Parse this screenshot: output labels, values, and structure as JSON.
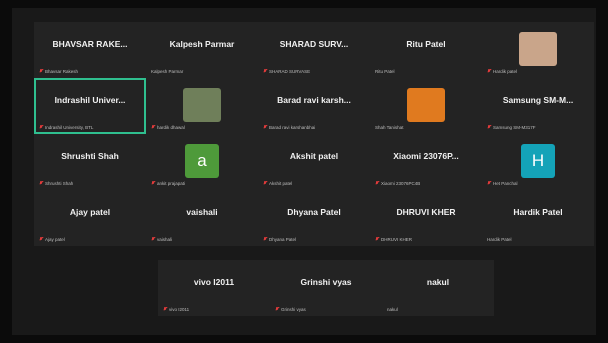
{
  "participants_main": [
    {
      "name": "BHAVSAR RAKE...",
      "sub": "Bhavsar Rakesh",
      "muted": true,
      "avatar": null
    },
    {
      "name": "Kalpesh Parmar",
      "sub": "Kalpesh Parmar",
      "muted": false,
      "avatar": null
    },
    {
      "name": "SHARAD SURV...",
      "sub": "SHARAD SURVASE",
      "muted": true,
      "avatar": null
    },
    {
      "name": "Ritu Patel",
      "sub": "Ritu Patel",
      "muted": false,
      "avatar": null
    },
    {
      "name": "",
      "sub": "Hardik patel",
      "muted": true,
      "avatar": {
        "type": "photo",
        "color": "#c9a58a"
      }
    },
    {
      "name": "Indrashil Univer...",
      "sub": "Indrashil University, BTL",
      "muted": true,
      "avatar": null,
      "active": true
    },
    {
      "name": "",
      "sub": "hardik dhawal",
      "muted": true,
      "avatar": {
        "type": "photo",
        "color": "#6f7f5a"
      }
    },
    {
      "name": "Barad ravi karsh...",
      "sub": "Barad ravi karshanbhai",
      "muted": true,
      "avatar": null
    },
    {
      "name": "",
      "sub": "Shah Tanishat",
      "muted": false,
      "avatar": {
        "type": "photo",
        "color": "#e07a1f"
      }
    },
    {
      "name": "Samsung SM-M...",
      "sub": "Samsung SM-M317F",
      "muted": true,
      "avatar": null
    },
    {
      "name": "Shrushti Shah",
      "sub": "Shrushti Shah",
      "muted": true,
      "avatar": null
    },
    {
      "name": "",
      "sub": "ankit prajapati",
      "muted": true,
      "avatar": {
        "type": "letter",
        "letter": "a",
        "color": "#4e9a3a"
      }
    },
    {
      "name": "Akshit patel",
      "sub": "Akshit patel",
      "muted": true,
      "avatar": null
    },
    {
      "name": "Xiaomi 23076P...",
      "sub": "Xiaomi 23076PC4B",
      "muted": true,
      "avatar": null
    },
    {
      "name": "",
      "sub": "Het Panchal",
      "muted": true,
      "avatar": {
        "type": "letter",
        "letter": "H",
        "color": "#14a3b8"
      }
    },
    {
      "name": "Ajay patel",
      "sub": "Ajay patel",
      "muted": true,
      "avatar": null
    },
    {
      "name": "vaishali",
      "sub": "vaishali",
      "muted": true,
      "avatar": null
    },
    {
      "name": "Dhyana Patel",
      "sub": "Dhyana Patel",
      "muted": true,
      "avatar": null
    },
    {
      "name": "DHRUVI KHER",
      "sub": "DHRUVI KHER",
      "muted": true,
      "avatar": null
    },
    {
      "name": "Hardik Patel",
      "sub": "Hardik Patel",
      "muted": false,
      "avatar": null
    }
  ],
  "participants_bottom": [
    {
      "name": "vivo I2011",
      "sub": "vivo I2011",
      "muted": true,
      "avatar": null
    },
    {
      "name": "Grinshi vyas",
      "sub": "Grinshi vyas",
      "muted": true,
      "avatar": null
    },
    {
      "name": "nakul",
      "sub": "nakul",
      "muted": false,
      "avatar": null
    }
  ],
  "colors": {
    "active_border": "#2fbf8f",
    "mute": "#e23b3b",
    "tile": "#232323"
  }
}
